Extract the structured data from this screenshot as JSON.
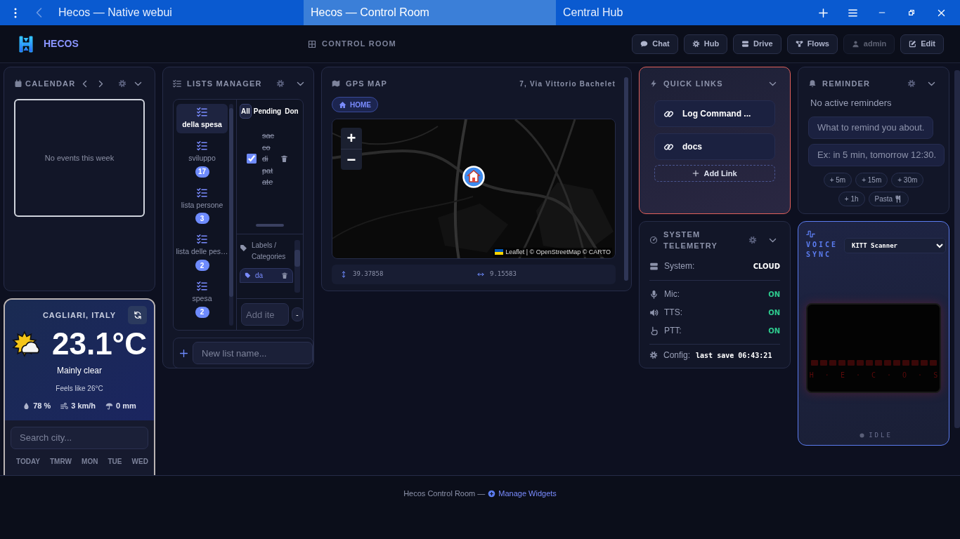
{
  "browser": {
    "tabs": [
      {
        "label": "Hecos — Native webui",
        "selected": false
      },
      {
        "label": "Hecos — Control Room",
        "selected": true
      },
      {
        "label": "Central Hub",
        "selected": false
      }
    ]
  },
  "header": {
    "brand": "HECOS",
    "title": "CONTROL ROOM",
    "buttons": [
      {
        "kind": "chat",
        "label": "Chat",
        "disabled": false
      },
      {
        "kind": "hub",
        "label": "Hub",
        "disabled": false
      },
      {
        "kind": "drive",
        "label": "Drive",
        "disabled": false
      },
      {
        "kind": "flows",
        "label": "Flows",
        "disabled": false
      },
      {
        "kind": "user",
        "label": "admin",
        "disabled": true
      },
      {
        "kind": "edit",
        "label": "Edit",
        "disabled": false
      }
    ]
  },
  "calendar": {
    "title": "CALENDAR",
    "empty_text": "No events this week"
  },
  "weather": {
    "city": "CAGLIARI, ITALY",
    "temperature": "23.1°C",
    "condition": "Mainly clear",
    "feels_like": "Feels like 26°C",
    "stats": [
      {
        "kind": "humidity",
        "value": "78 %"
      },
      {
        "kind": "wind",
        "value": "3 km/h"
      },
      {
        "kind": "rain",
        "value": "0 mm"
      }
    ],
    "search": {
      "placeholder": "Search city..."
    },
    "days": [
      "TODAY",
      "TMRW",
      "MON",
      "TUE",
      "WED"
    ]
  },
  "lists_manager": {
    "title": "LISTS MANAGER",
    "lists": [
      {
        "name": "della spesa",
        "selected": true
      },
      {
        "name": "sviluppo",
        "count": "17",
        "selected": false
      },
      {
        "name": "lista persone",
        "count": "3",
        "selected": false
      },
      {
        "name": "lista delle pes…",
        "count": "2",
        "selected": false
      },
      {
        "name": "spesa",
        "count": "2",
        "selected": false
      }
    ],
    "filters": [
      {
        "label": "All",
        "selected": true
      },
      {
        "label": "Pending",
        "selected": false
      },
      {
        "label": "Don",
        "selected": false
      }
    ],
    "items": [
      {
        "text": "sacco di patate",
        "done": true
      }
    ],
    "labels_title": "Labels / Categories",
    "tags": [
      "da"
    ],
    "add_item": {
      "placeholder": "Add ite"
    },
    "add_button": "-",
    "new_list": {
      "placeholder": "New list name..."
    }
  },
  "map": {
    "title": "GPS MAP",
    "address": "7, Via Vittorio Bachelet",
    "home_button": "HOME",
    "zoom_in": "+",
    "zoom_out": "−",
    "attribution": "Leaflet | © OpenStreetMap © CARTO",
    "coords": [
      {
        "kind": "lat",
        "value": "39.37858"
      },
      {
        "kind": "lon",
        "value": "9.15583"
      }
    ]
  },
  "quick_links": {
    "title": "QUICK LINKS",
    "links": [
      "Log Command ...",
      "docs"
    ],
    "add_label": "Add Link"
  },
  "reminder": {
    "title": "REMINDER",
    "empty_text": "No active reminders",
    "text_field": {
      "placeholder": "What to remind you about."
    },
    "time_field": {
      "placeholder": "Ex: in 5 min, tomorrow 12:30."
    },
    "chips": [
      {
        "kind": "time",
        "label": "+ 5m"
      },
      {
        "kind": "time",
        "label": "+ 15m"
      },
      {
        "kind": "time",
        "label": "+ 30m"
      },
      {
        "kind": "time",
        "label": "+ 1h"
      },
      {
        "kind": "food",
        "label": "Pasta"
      }
    ]
  },
  "telemetry": {
    "title": "SYSTEM TELEMETRY",
    "rows": [
      {
        "kind": "system",
        "label": "System:",
        "value": "CLOUD"
      },
      {
        "kind": "mic",
        "label": "Mic:",
        "value": "ON",
        "on": true
      },
      {
        "kind": "tts",
        "label": "TTS:",
        "value": "ON",
        "on": true
      },
      {
        "kind": "ptt",
        "label": "PTT:",
        "value": "ON",
        "on": true
      }
    ],
    "config": {
      "label": "Config:",
      "value": "last save 06:43:21"
    }
  },
  "voice_sync": {
    "title": "VOICE SYNC",
    "mode": "KITT Scanner",
    "scanner_text": "H · E · C · O · S",
    "status": "IDLE"
  },
  "footer": {
    "text": "Hecos Control Room —",
    "link": "Manage Widgets"
  }
}
